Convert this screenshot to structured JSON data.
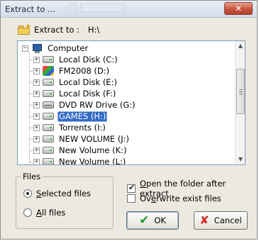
{
  "window": {
    "title": "Extract to ..."
  },
  "extract": {
    "label": "Extract to :",
    "path": "H:\\"
  },
  "tree": {
    "root": "Computer",
    "items": [
      {
        "label": "Local Disk (C:)",
        "icon": "hard-drive-icon"
      },
      {
        "label": "FM2008 (D:)",
        "icon": "fm2008-drive-icon"
      },
      {
        "label": "Local Disk (E:)",
        "icon": "hard-drive-icon"
      },
      {
        "label": "Local Disk (F:)",
        "icon": "hard-drive-icon"
      },
      {
        "label": "DVD RW Drive (G:)",
        "icon": "dvd-drive-icon"
      },
      {
        "label": "GAMES (H:)",
        "icon": "hard-drive-icon",
        "selected": true
      },
      {
        "label": "Torrents (I:)",
        "icon": "hard-drive-icon"
      },
      {
        "label": "NEW VOLUME (J:)",
        "icon": "hard-drive-icon"
      },
      {
        "label": "New Volume (K:)",
        "icon": "hard-drive-icon"
      },
      {
        "label": "New Volume (L:)",
        "icon": "hard-drive-icon"
      }
    ]
  },
  "files_group": {
    "legend": "Files",
    "options": [
      {
        "label": "Selected files",
        "checked": true
      },
      {
        "label": "All files",
        "checked": false
      }
    ]
  },
  "options": {
    "open_folder": {
      "label": "Open the folder after extract",
      "checked": true
    },
    "overwrite": {
      "label": "Overwrite exist files",
      "checked": false
    }
  },
  "buttons": {
    "ok": "OK",
    "cancel": "Cancel"
  },
  "colors": {
    "selection": "#316ac5",
    "ok_check": "#1c9b2c",
    "cancel_x": "#d02a1f"
  }
}
